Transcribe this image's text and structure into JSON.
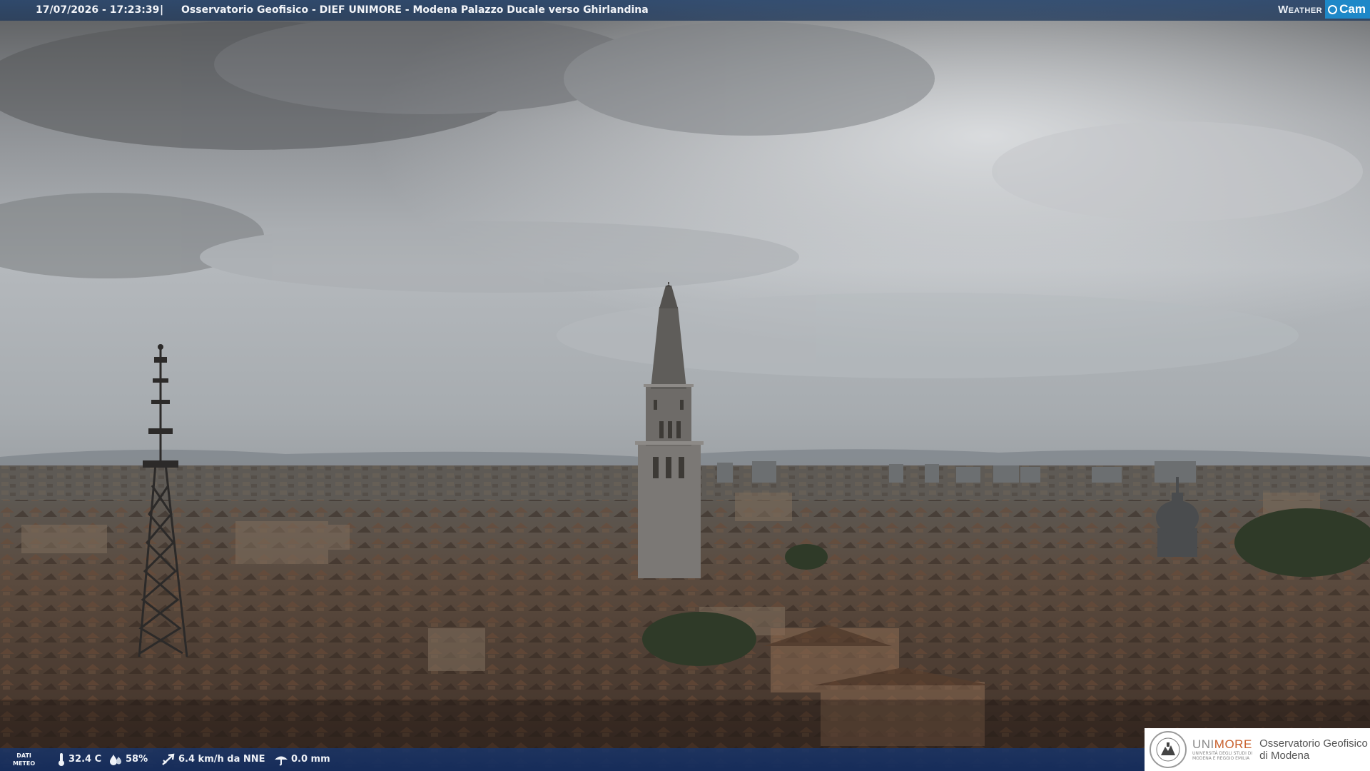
{
  "header": {
    "timestamp": "17/07/2026 - 17:23:39",
    "separator": "|",
    "title": "Osservatorio Geofisico - DIEF UNIMORE - Modena Palazzo Ducale verso Ghirlandina",
    "brand_weather": "Weather",
    "brand_cam": "Cam"
  },
  "footer": {
    "dati_label_1": "DATI",
    "dati_label_2": "METEO",
    "temperature": "32.4 C",
    "humidity": "58%",
    "wind": "6.4 km/h da NNE",
    "rain": "0.0 mm",
    "icons": [
      "thermometer-icon",
      "humidity-icon",
      "wind-icon",
      "rain-icon"
    ]
  },
  "logo": {
    "uni_part_1": "UNI",
    "uni_part_2": "MORE",
    "uni_subtitle_1": "UNIVERSITÀ DEGLI STUDI DI",
    "uni_subtitle_2": "MODENA E REGGIO EMILIA",
    "observatory_line_1": "Osservatorio Geofisico",
    "observatory_line_2": "di Modena"
  },
  "colors": {
    "header_bar": "#284670",
    "footer_bar": "#19376e",
    "brand_cam": "#1e88c8",
    "unimore_accent": "#c8602c"
  }
}
